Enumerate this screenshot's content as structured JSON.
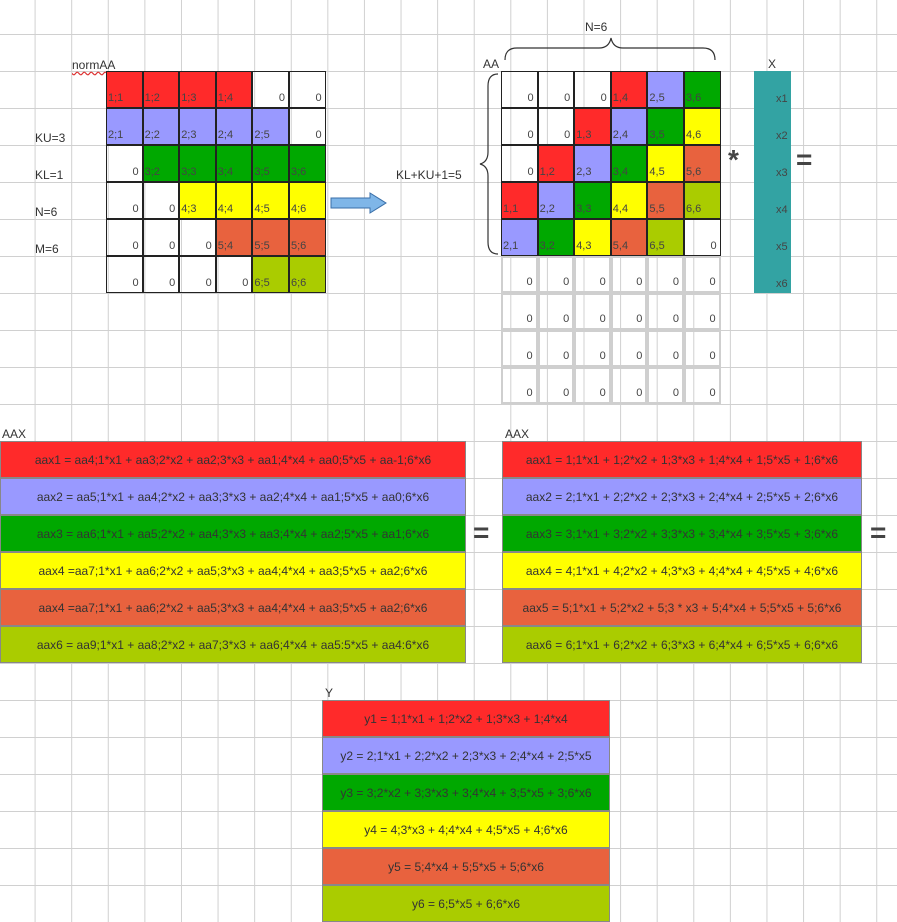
{
  "colors": {
    "red": "#ff2a2a",
    "blue": "#9999ff",
    "green": "#00a800",
    "yellow": "#ffff00",
    "orange": "#e8623e",
    "lime": "#aacc00",
    "teal": "#33a3a3",
    "arrow": "#7fb6e8"
  },
  "labels": {
    "normaa": "normAA",
    "ku": "KU=3",
    "kl": "KL=1",
    "n": "N=6",
    "m": "M=6",
    "aa": "AA",
    "n_top": "N=6",
    "klku": "KL+KU+1=5",
    "x": "X",
    "aax_left": "AAX",
    "aax_right": "AAX",
    "y": "Y",
    "times": "*",
    "equals": "="
  },
  "normAA": [
    [
      {
        "t": "1;1",
        "c": "red"
      },
      {
        "t": "1;2",
        "c": "red"
      },
      {
        "t": "1;3",
        "c": "red"
      },
      {
        "t": "1;4",
        "c": "red"
      },
      {
        "t": "0",
        "c": "none"
      },
      {
        "t": "0",
        "c": "none"
      }
    ],
    [
      {
        "t": "2;1",
        "c": "blue"
      },
      {
        "t": "2;2",
        "c": "blue"
      },
      {
        "t": "2;3",
        "c": "blue"
      },
      {
        "t": "2;4",
        "c": "blue"
      },
      {
        "t": "2;5",
        "c": "blue"
      },
      {
        "t": "0",
        "c": "none"
      }
    ],
    [
      {
        "t": "0",
        "c": "none"
      },
      {
        "t": "3;2",
        "c": "green"
      },
      {
        "t": "3;3",
        "c": "green"
      },
      {
        "t": "3;4",
        "c": "green"
      },
      {
        "t": "3;5",
        "c": "green"
      },
      {
        "t": "3;6",
        "c": "green"
      }
    ],
    [
      {
        "t": "0",
        "c": "none"
      },
      {
        "t": "0",
        "c": "none"
      },
      {
        "t": "4;3",
        "c": "yellow"
      },
      {
        "t": "4;4",
        "c": "yellow"
      },
      {
        "t": "4;5",
        "c": "yellow"
      },
      {
        "t": "4;6",
        "c": "yellow"
      }
    ],
    [
      {
        "t": "0",
        "c": "none"
      },
      {
        "t": "0",
        "c": "none"
      },
      {
        "t": "0",
        "c": "none"
      },
      {
        "t": "5;4",
        "c": "orange"
      },
      {
        "t": "5;5",
        "c": "orange"
      },
      {
        "t": "5;6",
        "c": "orange"
      }
    ],
    [
      {
        "t": "0",
        "c": "none"
      },
      {
        "t": "0",
        "c": "none"
      },
      {
        "t": "0",
        "c": "none"
      },
      {
        "t": "0",
        "c": "none"
      },
      {
        "t": "6;5",
        "c": "lime"
      },
      {
        "t": "6;6",
        "c": "lime"
      }
    ]
  ],
  "AA": [
    [
      {
        "t": "0",
        "c": "none"
      },
      {
        "t": "0",
        "c": "none"
      },
      {
        "t": "0",
        "c": "none"
      },
      {
        "t": "1,4",
        "c": "red"
      },
      {
        "t": "2,5",
        "c": "blue"
      },
      {
        "t": "3,6",
        "c": "green"
      }
    ],
    [
      {
        "t": "0",
        "c": "none"
      },
      {
        "t": "0",
        "c": "none"
      },
      {
        "t": "1,3",
        "c": "red"
      },
      {
        "t": "2,4",
        "c": "blue"
      },
      {
        "t": "3,5",
        "c": "green"
      },
      {
        "t": "4,6",
        "c": "yellow"
      }
    ],
    [
      {
        "t": "0",
        "c": "none"
      },
      {
        "t": "1,2",
        "c": "red"
      },
      {
        "t": "2,3",
        "c": "blue"
      },
      {
        "t": "3,4",
        "c": "green"
      },
      {
        "t": "4,5",
        "c": "yellow"
      },
      {
        "t": "5,6",
        "c": "orange"
      }
    ],
    [
      {
        "t": "1,1",
        "c": "red"
      },
      {
        "t": "2,2",
        "c": "blue"
      },
      {
        "t": "3,3",
        "c": "green"
      },
      {
        "t": "4,4",
        "c": "yellow"
      },
      {
        "t": "5,5",
        "c": "orange"
      },
      {
        "t": "6,6",
        "c": "lime"
      }
    ],
    [
      {
        "t": "2,1",
        "c": "blue"
      },
      {
        "t": "3,2",
        "c": "green"
      },
      {
        "t": "4,3",
        "c": "yellow"
      },
      {
        "t": "5,4",
        "c": "orange"
      },
      {
        "t": "6,5",
        "c": "lime"
      },
      {
        "t": "0",
        "c": "none"
      }
    ]
  ],
  "AA_zero_rows": [
    [
      "0",
      "0",
      "0",
      "0",
      "0",
      "0"
    ],
    [
      "0",
      "0",
      "0",
      "0",
      "0",
      "0"
    ],
    [
      "0",
      "0",
      "0",
      "0",
      "0",
      "0"
    ],
    [
      "0",
      "0",
      "0",
      "0",
      "0",
      "0"
    ]
  ],
  "X": [
    "x1",
    "x2",
    "x3",
    "x4",
    "x5",
    "x6"
  ],
  "aax_left_rows": [
    {
      "t": "aax1 = aa4;1*x1 + aa3;2*x2 + aa2;3*x3 + aa1;4*x4 + aa0;5*x5 + aa-1;6*x6",
      "c": "red"
    },
    {
      "t": "aax2 = aa5;1*x1 + aa4;2*x2 + aa3;3*x3 + aa2;4*x4 + aa1;5*x5 + aa0;6*x6",
      "c": "blue"
    },
    {
      "t": "aax3 = aa6;1*x1 + aa5;2*x2 + aa4;3*x3 + aa3;4*x4 + aa2;5*x5 + aa1;6*x6",
      "c": "green"
    },
    {
      "t": "aax4 =aa7;1*x1 + aa6;2*x2 + aa5;3*x3 + aa4;4*x4 + aa3;5*x5 + aa2;6*x6",
      "c": "yellow"
    },
    {
      "t": "aax4 =aa7;1*x1 + aa6;2*x2 + aa5;3*x3 + aa4;4*x4 + aa3;5*x5 + aa2;6*x6",
      "c": "orange"
    },
    {
      "t": "aax6 = aa9;1*x1 + aa8;2*x2 + aa7;3*x3 + aa6;4*x4 + aa5:5*x5 + aa4:6*x6",
      "c": "lime"
    }
  ],
  "aax_right_rows": [
    {
      "t": "aax1 = 1;1*x1 + 1;2*x2 + 1;3*x3 + 1;4*x4 + 1;5*x5 + 1;6*x6",
      "c": "red"
    },
    {
      "t": "aax2 = 2;1*x1 + 2;2*x2 + 2;3*x3 + 2;4*x4 + 2;5*x5 + 2;6*x6",
      "c": "blue"
    },
    {
      "t": "aax3 = 3;1*x1 + 3;2*x2 + 3;3*x3 + 3;4*x4 + 3;5*x5 + 3;6*x6",
      "c": "green"
    },
    {
      "t": "aax4 = 4;1*x1 + 4;2*x2 + 4;3*x3 + 4;4*x4 + 4;5*x5 + 4;6*x6",
      "c": "yellow"
    },
    {
      "t": "aax5 = 5;1*x1 + 5;2*x2 + 5;3 * x3 + 5;4*x4 + 5;5*x5 + 5;6*x6",
      "c": "orange"
    },
    {
      "t": "aax6 = 6;1*x1 + 6;2*x2 + 6;3*x3 + 6;4*x4 + 6;5*x5 + 6;6*x6",
      "c": "lime"
    }
  ],
  "y_rows": [
    {
      "t": "y1 = 1;1*x1 + 1;2*x2 + 1;3*x3 + 1;4*x4",
      "c": "red"
    },
    {
      "t": "y2 = 2;1*x1 + 2;2*x2 + 2;3*x3 + 2;4*x4 + 2;5*x5",
      "c": "blue"
    },
    {
      "t": "y3 = 3;2*x2 + 3;3*x3 + 3;4*x4 + 3;5*x5 + 3;6*x6",
      "c": "green"
    },
    {
      "t": "y4 = 4;3*x3 + 4;4*x4 + 4;5*x5 + 4;6*x6",
      "c": "yellow"
    },
    {
      "t": "y5 = 5;4*x4 + 5;5*x5 + 5;6*x6",
      "c": "orange"
    },
    {
      "t": "y6 = 6;5*x5 + 6;6*x6",
      "c": "lime"
    }
  ]
}
